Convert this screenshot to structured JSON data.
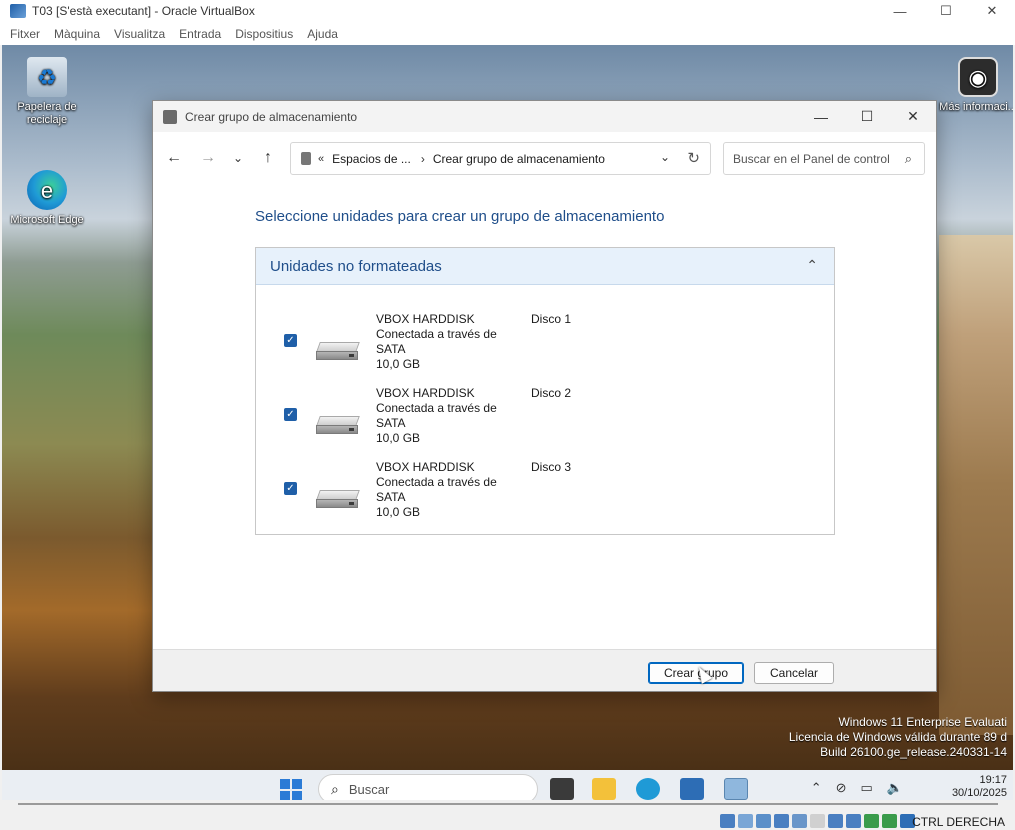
{
  "host_window": {
    "title": "T03 [S'està executant] - Oracle VirtualBox",
    "controls": [
      "—",
      "☐",
      "✕"
    ],
    "menu": [
      "Fitxer",
      "Màquina",
      "Visualitza",
      "Entrada",
      "Dispositius",
      "Ajuda"
    ]
  },
  "desktop": {
    "icons": [
      {
        "label": "Papelera de reciclaje",
        "icon": "recycle-bin-icon"
      },
      {
        "label": "Microsoft Edge",
        "icon": "edge-icon"
      },
      {
        "label": "Más informaci...",
        "icon": "info-icon"
      }
    ],
    "watermark": [
      "Windows 11 Enterprise Evaluati",
      "Licencia de Windows válida durante 89 d",
      "Build 26100.ge_release.240331-14"
    ]
  },
  "dialog": {
    "title": "Crear grupo de almacenamiento",
    "controls": [
      "—",
      "☐",
      "✕"
    ],
    "address": {
      "overflow": "«",
      "crumbs": [
        "Espacios de ...",
        "Crear grupo de almacenamiento"
      ],
      "separator": "›"
    },
    "search": {
      "placeholder": "Buscar en el Panel de control"
    },
    "heading": "Seleccione unidades para crear un grupo de almacenamiento",
    "panel": {
      "title": "Unidades no formateadas",
      "drives": [
        {
          "name": "VBOX HARDDISK",
          "connection": "Conectada a través de SATA",
          "size": "10,0 GB",
          "disk": "Disco 1",
          "checked": true
        },
        {
          "name": "VBOX HARDDISK",
          "connection": "Conectada a través de SATA",
          "size": "10,0 GB",
          "disk": "Disco 2",
          "checked": true
        },
        {
          "name": "VBOX HARDDISK",
          "connection": "Conectada a través de SATA",
          "size": "10,0 GB",
          "disk": "Disco 3",
          "checked": true
        }
      ]
    },
    "buttons": {
      "create": "Crear grupo",
      "cancel": "Cancelar"
    }
  },
  "taskbar": {
    "search_label": "Buscar",
    "time": "19:17",
    "date": "30/10/2025"
  },
  "statusbar": {
    "host_key": "CTRL DERECHA"
  }
}
